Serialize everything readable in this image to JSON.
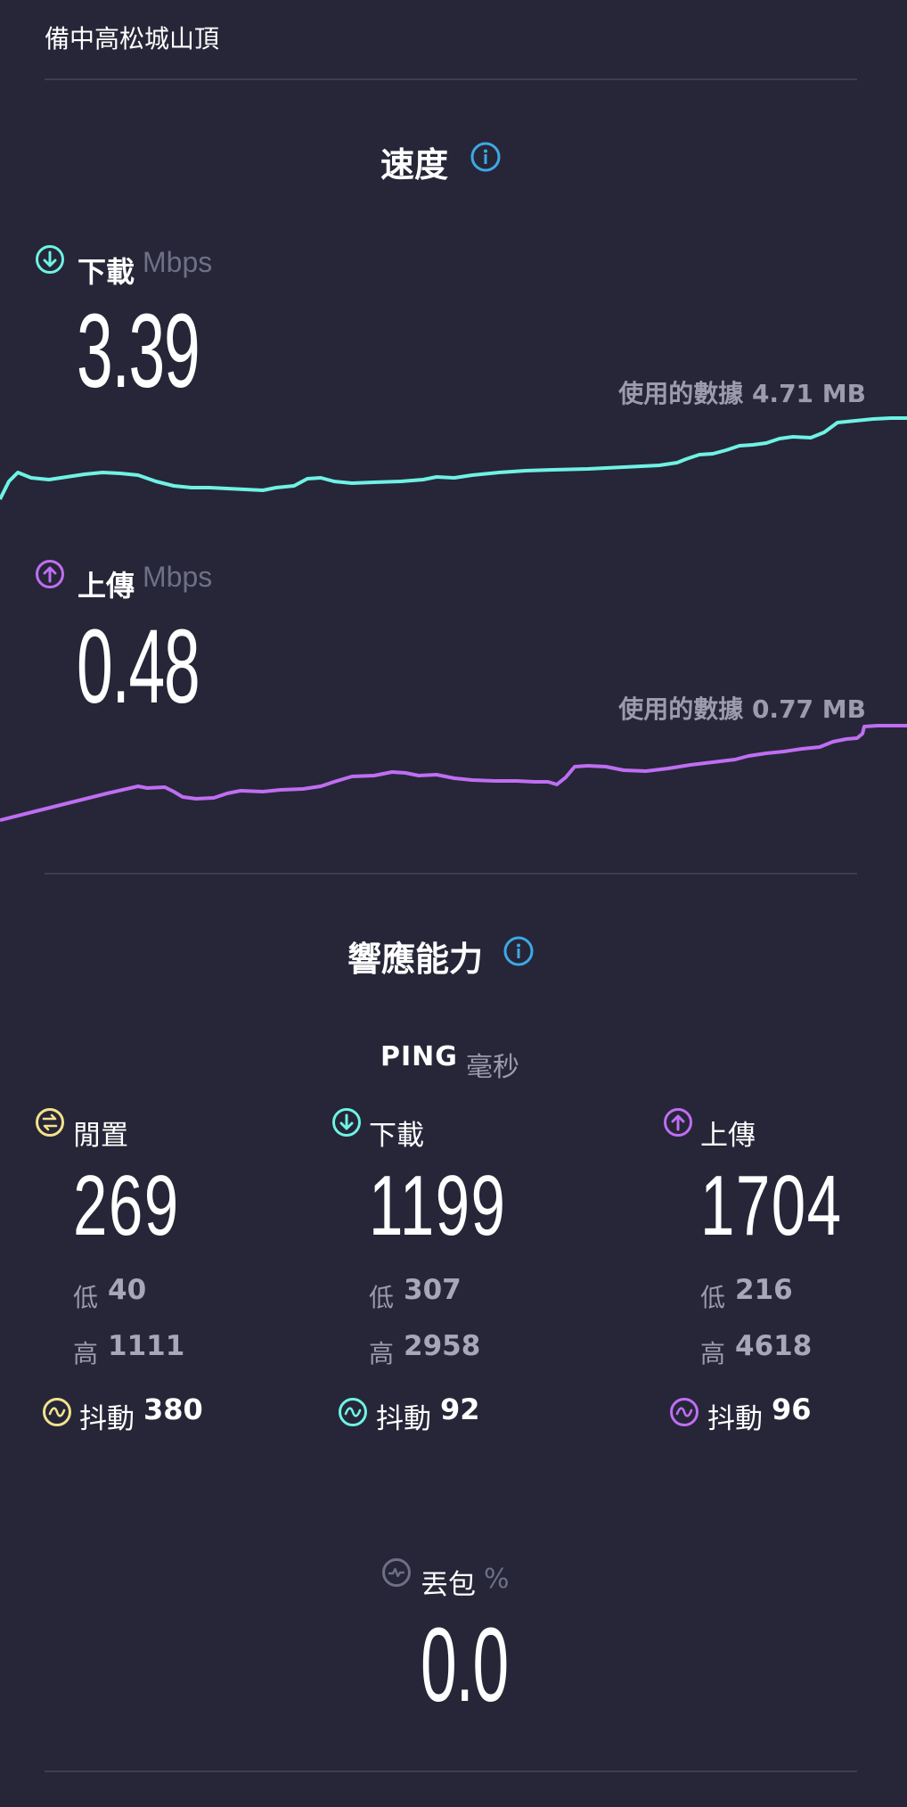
{
  "location": "備中高松城山頂",
  "speed": {
    "title": "速度",
    "info_icon": "info-icon",
    "download": {
      "label": "下載",
      "unit": "Mbps",
      "value": "3.39",
      "data_used": "使用的數據 4.71 MB",
      "color": "#6ff2e4",
      "icon": "arrow-down-circle-icon"
    },
    "upload": {
      "label": "上傳",
      "unit": "Mbps",
      "value": "0.48",
      "data_used": "使用的數據 0.77 MB",
      "color": "#bf6ef2",
      "icon": "arrow-up-circle-icon"
    }
  },
  "responsiveness": {
    "title": "響應能力",
    "info_icon": "info-icon",
    "ping_label": "PING",
    "ping_unit": "毫秒",
    "idle": {
      "label": "閒置",
      "value": "269",
      "low_label": "低",
      "low": "40",
      "high_label": "高",
      "high": "1111",
      "jitter_label": "抖動",
      "jitter": "380",
      "color": "#f3e28c",
      "icon": "idle-arrows-circle-icon"
    },
    "download": {
      "label": "下載",
      "value": "1199",
      "low_label": "低",
      "low": "307",
      "high_label": "高",
      "high": "2958",
      "jitter_label": "抖動",
      "jitter": "92",
      "color": "#6ff2e4",
      "icon": "arrow-down-circle-icon"
    },
    "upload": {
      "label": "上傳",
      "value": "1704",
      "low_label": "低",
      "low": "216",
      "high_label": "高",
      "high": "4618",
      "jitter_label": "抖動",
      "jitter": "96",
      "color": "#bf6ef2",
      "icon": "arrow-up-circle-icon"
    }
  },
  "packet_loss": {
    "label": "丟包",
    "unit": "%",
    "value": "0.0",
    "icon": "packet-loss-icon"
  },
  "accent_color": "#3ea8e6"
}
